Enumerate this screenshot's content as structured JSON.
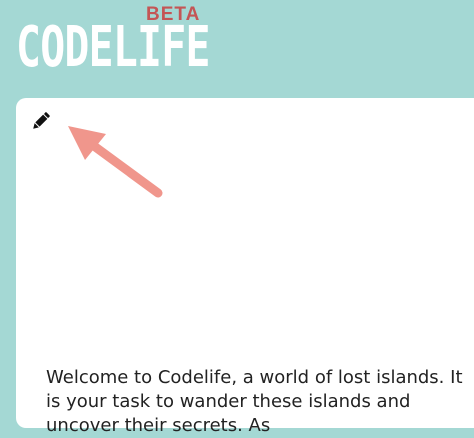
{
  "header": {
    "logo_text": "CODELIFE",
    "badge_text": "BETA"
  },
  "panel": {
    "edit_icon": "pencil-icon",
    "annotation_icon": "arrow-pointer-icon",
    "welcome_text": "Welcome to Codelife, a world of lost islands. It is your task to wander these islands and uncover their secrets. As"
  },
  "colors": {
    "background": "#a4d8d4",
    "panel": "#ffffff",
    "badge": "#c45555",
    "arrow": "#f0968c",
    "text": "#222222"
  }
}
